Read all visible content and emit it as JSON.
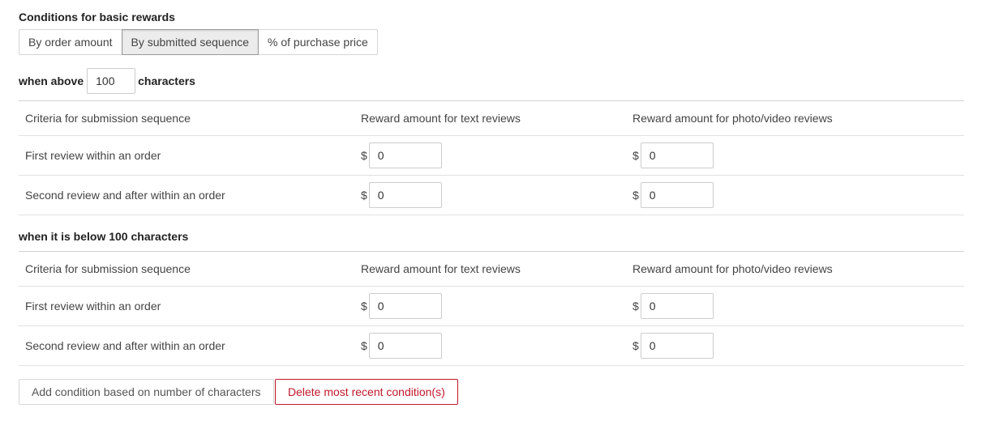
{
  "section_title": "Conditions for basic rewards",
  "mode_tabs": [
    {
      "label": "By order amount",
      "active": false
    },
    {
      "label": "By submitted sequence",
      "active": true
    },
    {
      "label": "% of purchase price",
      "active": false
    }
  ],
  "threshold": {
    "prefix": "when above",
    "value": "100",
    "suffix": "characters"
  },
  "above_table": {
    "headers": [
      "Criteria for submission sequence",
      "Reward amount for text reviews",
      "Reward amount for photo/video reviews"
    ],
    "rows": [
      {
        "label": "First review within an order",
        "currency": "$",
        "text_reward": "0",
        "media_reward": "0"
      },
      {
        "label": "Second review and after within an order",
        "currency": "$",
        "text_reward": "0",
        "media_reward": "0"
      }
    ]
  },
  "below_title": "when it is below 100 characters",
  "below_table": {
    "headers": [
      "Criteria for submission sequence",
      "Reward amount for text reviews",
      "Reward amount for photo/video reviews"
    ],
    "rows": [
      {
        "label": "First review within an order",
        "currency": "$",
        "text_reward": "0",
        "media_reward": "0"
      },
      {
        "label": "Second review and after within an order",
        "currency": "$",
        "text_reward": "0",
        "media_reward": "0"
      }
    ]
  },
  "buttons": {
    "add_label": "Add condition based on number of characters",
    "delete_label": "Delete most recent condition(s)"
  },
  "colors": {
    "danger": "#c0182b",
    "active_tab_bg": "#ececec",
    "border": "#d6d6d6"
  }
}
